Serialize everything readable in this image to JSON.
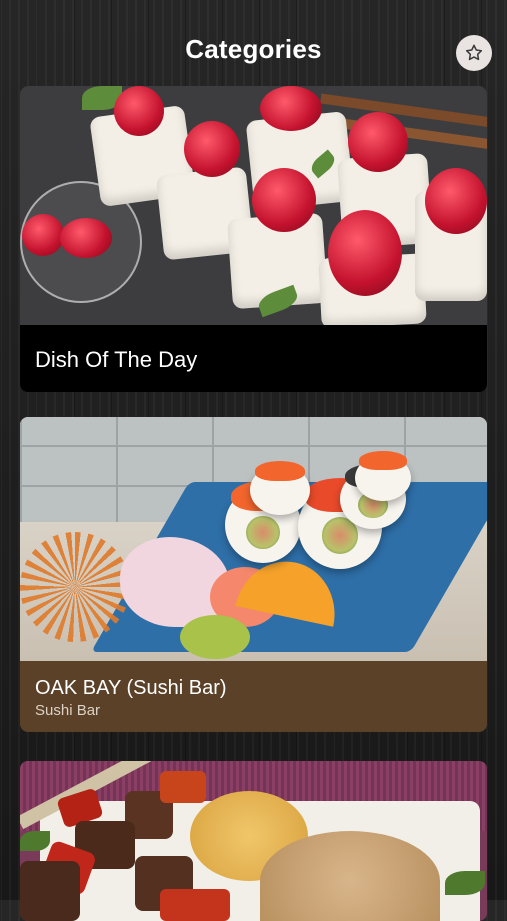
{
  "header": {
    "title": "Categories",
    "favorite_icon": "star-outline-icon"
  },
  "categories": [
    {
      "title": "Dish Of The Day",
      "subtitle": "",
      "image": "sushi-rolls-with-raspberries"
    },
    {
      "title": "OAK BAY (Sushi Bar)",
      "subtitle": "Sushi Bar",
      "image": "sushi-platter-on-blue-plate"
    },
    {
      "title": "",
      "subtitle": "",
      "image": "kebab-skewers-and-rice"
    }
  ],
  "colors": {
    "background": "#1e1e1e",
    "card1_caption_bg": "#000000",
    "card2_caption_bg": "#5b4128",
    "favorite_button_bg": "#e9e4e1"
  }
}
